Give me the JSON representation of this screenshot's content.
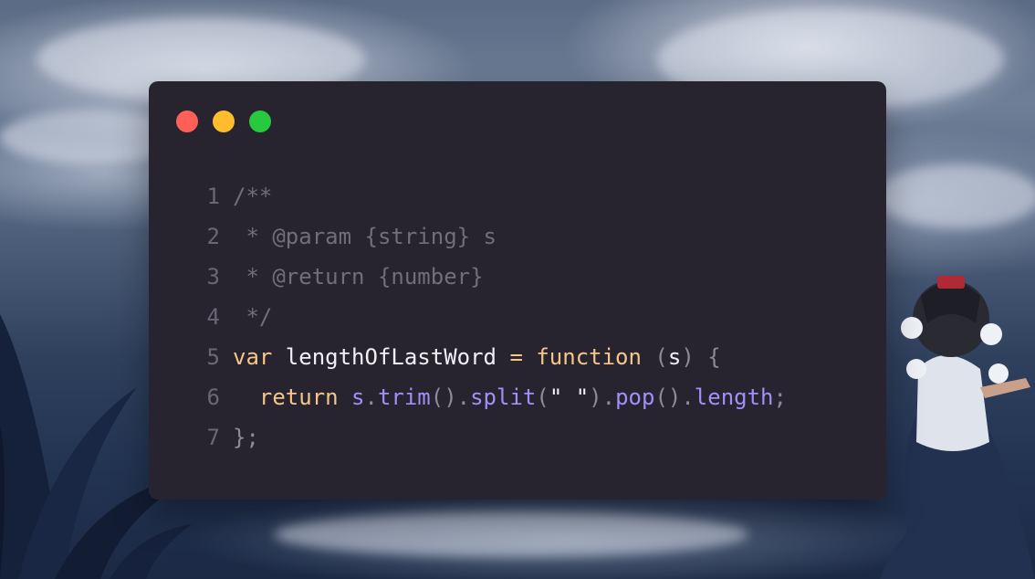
{
  "window_controls": {
    "close_color": "#ff5f56",
    "minimize_color": "#ffbd2e",
    "maximize_color": "#27c93f"
  },
  "code_lines": [
    {
      "number": "1",
      "tokens": [
        {
          "text": "/**",
          "kind": "comment"
        }
      ]
    },
    {
      "number": "2",
      "tokens": [
        {
          "text": " * @param {string} s",
          "kind": "comment"
        }
      ]
    },
    {
      "number": "3",
      "tokens": [
        {
          "text": " * @return {number}",
          "kind": "comment"
        }
      ]
    },
    {
      "number": "4",
      "tokens": [
        {
          "text": " */",
          "kind": "comment"
        }
      ]
    },
    {
      "number": "5",
      "tokens": [
        {
          "text": "var",
          "kind": "kw"
        },
        {
          "text": " lengthOfLastWord ",
          "kind": "ident"
        },
        {
          "text": "=",
          "kind": "op"
        },
        {
          "text": " function ",
          "kind": "kw"
        },
        {
          "text": "(",
          "kind": "punct"
        },
        {
          "text": "s",
          "kind": "ident"
        },
        {
          "text": ") {",
          "kind": "punct"
        }
      ]
    },
    {
      "number": "6",
      "tokens": [
        {
          "text": "  return",
          "kind": "kw"
        },
        {
          "text": " s",
          "kind": "prop"
        },
        {
          "text": ".",
          "kind": "punct"
        },
        {
          "text": "trim",
          "kind": "prop"
        },
        {
          "text": "().",
          "kind": "punct"
        },
        {
          "text": "split",
          "kind": "prop"
        },
        {
          "text": "(",
          "kind": "punct"
        },
        {
          "text": "\" \"",
          "kind": "str"
        },
        {
          "text": ").",
          "kind": "punct"
        },
        {
          "text": "pop",
          "kind": "prop"
        },
        {
          "text": "().",
          "kind": "punct"
        },
        {
          "text": "length",
          "kind": "prop"
        },
        {
          "text": ";",
          "kind": "punct"
        }
      ]
    },
    {
      "number": "7",
      "tokens": [
        {
          "text": "};",
          "kind": "punct"
        }
      ]
    }
  ]
}
